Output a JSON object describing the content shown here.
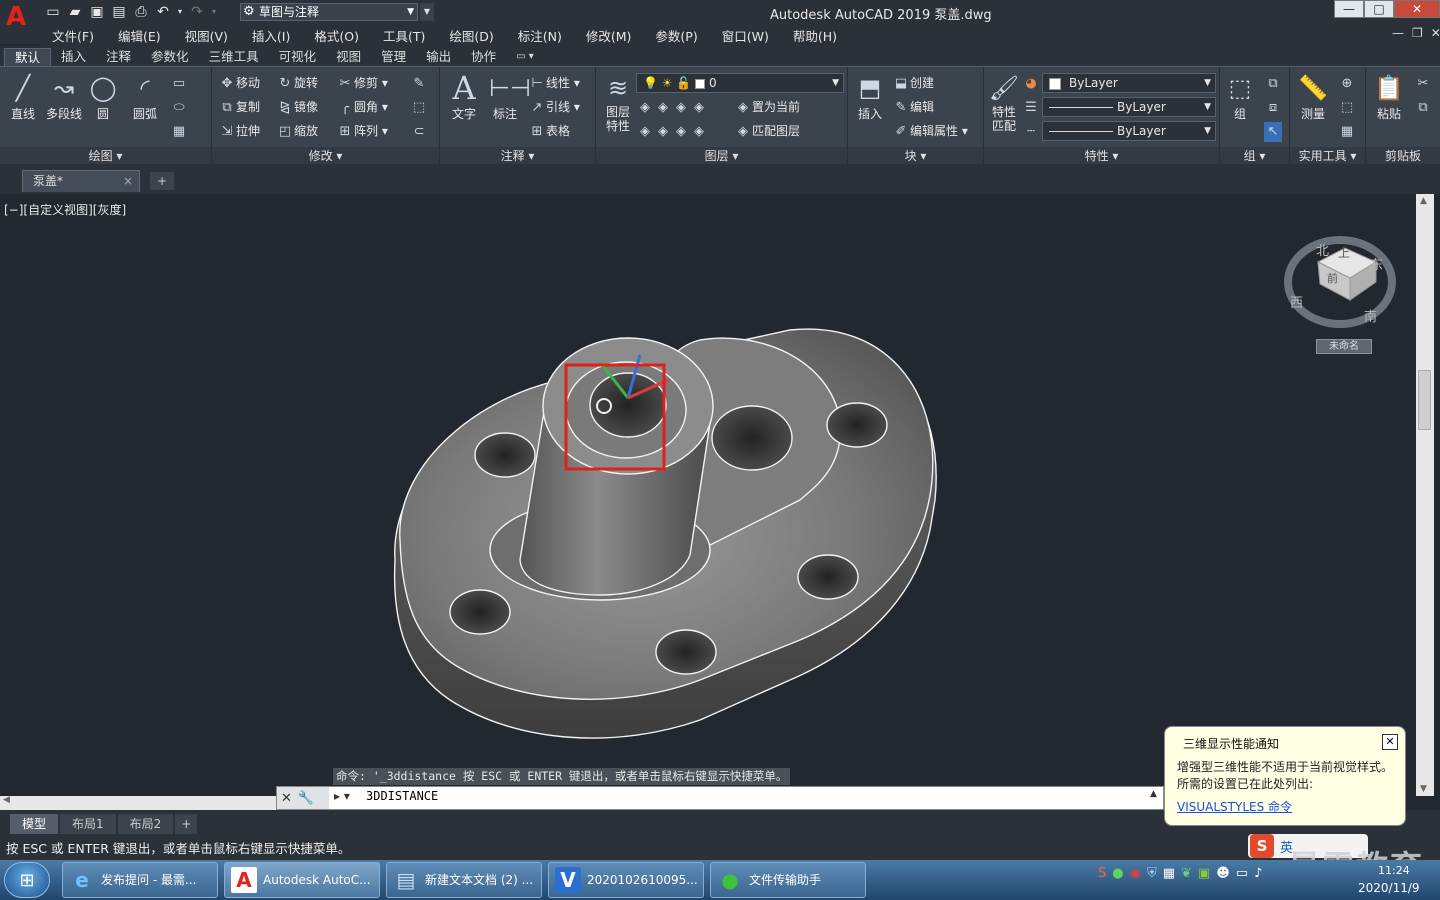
{
  "title_bar": {
    "app_letter": "A",
    "workspace": "草图与注释",
    "window_title": "Autodesk AutoCAD 2019    泵盖.dwg",
    "buttons": {
      "minimize": "—",
      "maximize": "□",
      "close": "✕"
    }
  },
  "menu_bar": [
    "文件(F)",
    "编辑(E)",
    "视图(V)",
    "插入(I)",
    "格式(O)",
    "工具(T)",
    "绘图(D)",
    "标注(N)",
    "修改(M)",
    "参数(P)",
    "窗口(W)",
    "帮助(H)"
  ],
  "ribbon_tabs": [
    "默认",
    "插入",
    "注释",
    "参数化",
    "三维工具",
    "可视化",
    "视图",
    "管理",
    "输出",
    "协作"
  ],
  "ribbon": {
    "draw": {
      "title": "绘图",
      "line": "直线",
      "polyline": "多段线",
      "circle": "圆",
      "arc": "圆弧"
    },
    "modify": {
      "title": "修改",
      "move": "移动",
      "rotate": "旋转",
      "trim": "修剪",
      "copy": "复制",
      "mirror": "镜像",
      "fillet": "圆角",
      "stretch": "拉伸",
      "scale": "缩放",
      "array": "阵列"
    },
    "annotation": {
      "title": "注释",
      "text": "文字",
      "dimension": "标注",
      "linear": "线性",
      "leader": "引线",
      "table": "表格"
    },
    "layers": {
      "title": "图层",
      "layer_props_1": "图层",
      "layer_props_2": "特性",
      "current_layer": "0",
      "set_current": "置为当前",
      "match_layer": "匹配图层"
    },
    "block": {
      "title": "块",
      "insert": "插入",
      "create": "创建",
      "edit": "编辑",
      "edit_attr": "编辑属性"
    },
    "properties": {
      "title": "特性",
      "match_1": "特性",
      "match_2": "匹配",
      "color": "ByLayer",
      "linetype": "ByLayer",
      "lineweight": "ByLayer"
    },
    "groups": {
      "title": "组",
      "group": "组"
    },
    "utilities": {
      "title": "实用工具",
      "measure": "测量"
    },
    "clipboard": {
      "title": "剪贴板",
      "paste": "粘贴"
    }
  },
  "doc_tab": {
    "name": "泵盖*",
    "close": "×",
    "new": "+"
  },
  "viewport": {
    "label": "[−][自定义视图][灰度]"
  },
  "viewcube": {
    "north": "北",
    "west": "西",
    "east": "东",
    "south": "南",
    "top": "上",
    "front": "前",
    "wcs": "未命名"
  },
  "command": {
    "history": "命令: '_3ddistance 按 ESC 或 ENTER 键退出，或者单击鼠标右键显示快捷菜单。",
    "value": "3DDISTANCE"
  },
  "layout_tabs": [
    "模型",
    "布局1",
    "布局2"
  ],
  "status_message": "按 ESC 或 ENTER 键退出，或者单击鼠标右键显示快捷菜单。",
  "notification": {
    "title": "三维显示性能通知",
    "body1": "增强型三维性能不适用于当前视觉样式。",
    "body2": "所需的设置已在此处列出:",
    "link": "VISUALSTYLES 命令"
  },
  "ime": {
    "label": "英"
  },
  "watermark": "最需教育",
  "taskbar": {
    "items": [
      "发布提问 - 最需...",
      "Autodesk AutoC...",
      "新建文本文档 (2) ...",
      "2020102610095...",
      "文件传输助手"
    ],
    "time": "11:24",
    "date": "2020/11/9"
  },
  "colors": {
    "accent": "#e2231a",
    "highlight_box": "#e0201a",
    "notification_bg": "#ffffe4",
    "link": "#1a4fd6"
  }
}
